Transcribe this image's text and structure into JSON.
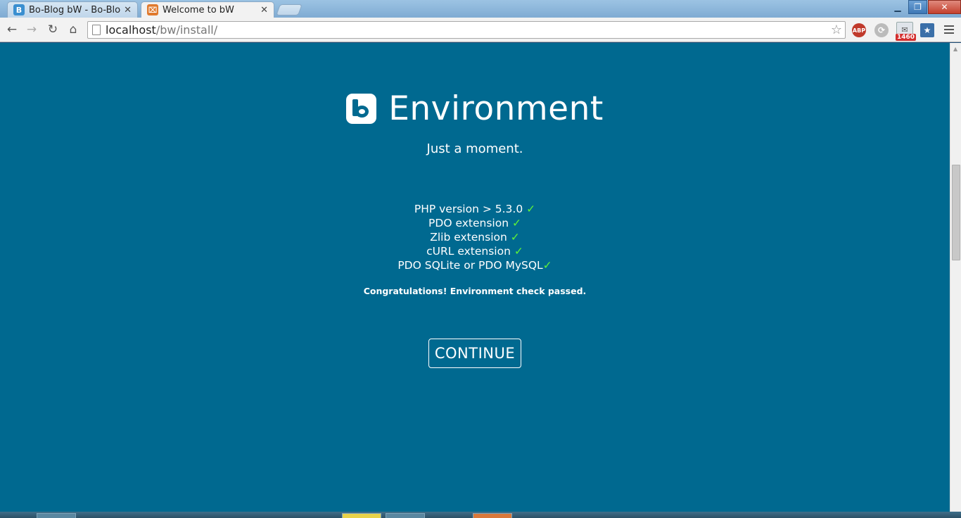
{
  "browser": {
    "tabs": [
      {
        "title": "Bo-Blog bW - Bo-Blog",
        "favicon_letter": "B",
        "favicon_color": "#3a8fd0",
        "active": false
      },
      {
        "title": "Welcome to bW",
        "favicon_letter": "⌧",
        "favicon_color": "#e07a2e",
        "active": true
      }
    ],
    "address": {
      "host": "localhost",
      "path": "/bw/install/"
    },
    "mail_badge": "1460",
    "abp_label": "ABP"
  },
  "page": {
    "title": "Environment",
    "subtitle": "Just a moment.",
    "checks": [
      {
        "label": "PHP version > 5.3.0 ",
        "mark": "✓"
      },
      {
        "label": "PDO extension ",
        "mark": "✓"
      },
      {
        "label": "Zlib extension ",
        "mark": "✓"
      },
      {
        "label": "cURL extension ",
        "mark": "✓"
      },
      {
        "label": "PDO SQLite or PDO MySQL",
        "mark": "✓"
      }
    ],
    "message": "Congratulations! Environment check passed.",
    "continue_label": "CONTINUE",
    "background_color": "#006990",
    "check_color": "#5df03a"
  }
}
